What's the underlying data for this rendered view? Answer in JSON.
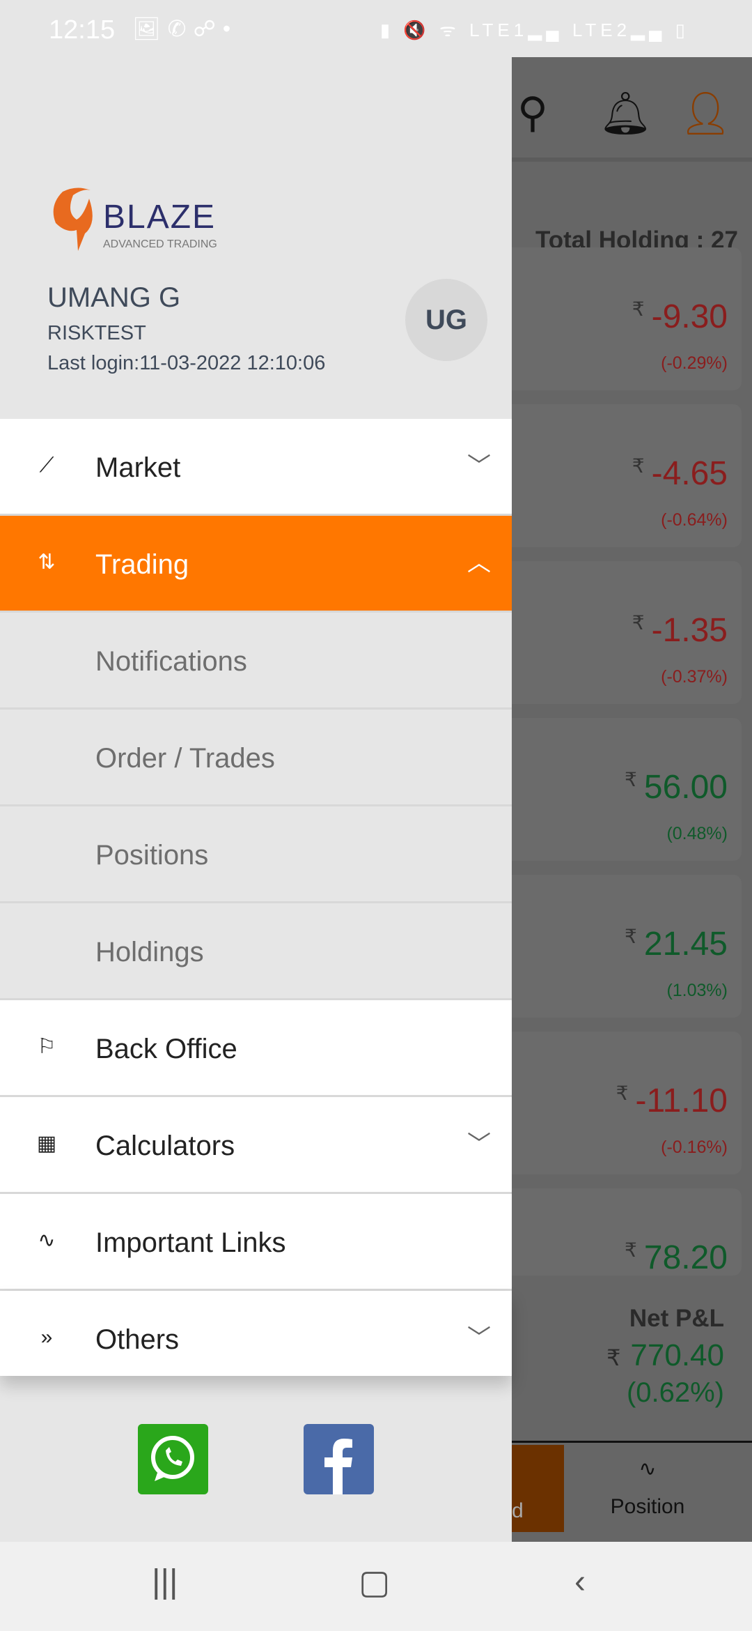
{
  "status_bar": {
    "time": "12:15",
    "left_icons": [
      "image-icon",
      "whatsapp-icon",
      "missed-call-icon",
      "dot-icon"
    ],
    "right_icons": [
      "battery-saver-icon",
      "mute-icon",
      "wifi-icon",
      "lte1-signal-icon",
      "lte2-signal-icon",
      "battery-low-icon"
    ],
    "lte1": "LTE1",
    "lte2": "LTE2"
  },
  "drawer": {
    "logo": {
      "brand": "BLAZE",
      "tagline": "ADVANCED TRADING"
    },
    "user": {
      "name": "UMANG G",
      "account": "RISKTEST",
      "last_login": "Last login:11-03-2022 12:10:06",
      "initials": "UG"
    },
    "menu": [
      {
        "label": "Market",
        "icon": "trend-up-icon",
        "expand": "chevron-down"
      },
      {
        "label": "Trading",
        "icon": "up-down-arrows-icon",
        "expand": "chevron-up",
        "active": true
      },
      {
        "label": "Notifications",
        "sub": true
      },
      {
        "label": "Order / Trades",
        "sub": true
      },
      {
        "label": "Positions",
        "sub": true
      },
      {
        "label": "Holdings",
        "sub": true
      },
      {
        "label": "Back Office",
        "icon": "ipo-signpost-icon"
      },
      {
        "label": "Calculators",
        "icon": "calculator-icon",
        "expand": "chevron-down"
      },
      {
        "label": "Important Links",
        "icon": "links-icon"
      },
      {
        "label": "Others",
        "icon": "double-chevron-right-icon",
        "expand": "chevron-down"
      }
    ],
    "social": [
      "whatsapp",
      "facebook"
    ]
  },
  "background": {
    "total_holding": "Total Holding : 27",
    "currency": "₹",
    "holdings": [
      {
        "change": "-9.30",
        "pct": "(-0.29%)",
        "dir": "neg"
      },
      {
        "change": "-4.65",
        "pct": "(-0.64%)",
        "dir": "neg"
      },
      {
        "change": "-1.35",
        "pct": "(-0.37%)",
        "dir": "neg"
      },
      {
        "change": "56.00",
        "pct": "(0.48%)",
        "dir": "pos"
      },
      {
        "change": "21.45",
        "pct": "(1.03%)",
        "dir": "pos"
      },
      {
        "change": "-11.10",
        "pct": "(-0.16%)",
        "dir": "neg"
      },
      {
        "change": "78.20",
        "pct": "",
        "dir": "pos"
      }
    ],
    "net_pnl": {
      "label": "Net P&L",
      "value": "770.40",
      "pct": "(0.62%)"
    },
    "tabs": {
      "partial": "d",
      "position": "Position"
    }
  },
  "colors": {
    "accent": "#ff7700",
    "negative": "#c62828",
    "positive": "#1b7a3a"
  }
}
